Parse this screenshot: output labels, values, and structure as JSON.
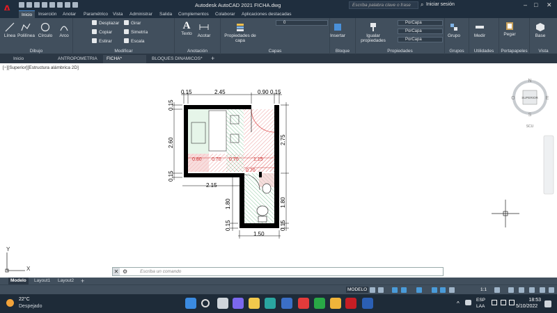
{
  "app": {
    "window_title": "Autodesk AutoCAD 2021   FICHA.dwg",
    "search_placeholder": "Escriba palabra clave o frase",
    "signin": "Iniciar sesión"
  },
  "ribbon_tabs": [
    "Inicio",
    "Inserción",
    "Anotar",
    "Paramétrico",
    "Vista",
    "Administrar",
    "Salida",
    "Complementos",
    "Colaborar",
    "Aplicaciones destacadas"
  ],
  "panels": {
    "dibujo": {
      "title": "Dibujo",
      "tools": [
        "Línea",
        "Polilínea",
        "Círculo",
        "Arco"
      ]
    },
    "modificar": {
      "title": "Modificar",
      "tools": [
        "Desplazar",
        "Girar",
        "Copiar",
        "Simetría",
        "Estirar",
        "Escala"
      ]
    },
    "anotacion": {
      "title": "Anotación",
      "tools": [
        "Texto",
        "Acotar"
      ]
    },
    "capas": {
      "title": "Capas",
      "props_label": "Propiedades de capa",
      "layer_value": "0"
    },
    "bloque": {
      "title": "Bloque",
      "tools": [
        "Insertar"
      ]
    },
    "propiedades": {
      "title": "Propiedades",
      "match": "Igualar propiedades",
      "bylayer1": "PorCapa",
      "bylayer2": "PorCapa",
      "bylayer3": "PorCapa"
    },
    "grupos": {
      "title": "Grupos",
      "tools": [
        "Grupo"
      ]
    },
    "utilidades": {
      "title": "Utilidades",
      "tools": [
        "Medir"
      ]
    },
    "portapapeles": {
      "title": "Portapapeles",
      "tools": [
        "Pegar"
      ]
    },
    "vista": {
      "title": "Vista",
      "tools": [
        "Base"
      ]
    }
  },
  "doc_tabs": [
    "Inicio",
    "ANTROPOMETRIA",
    "FICHA*",
    "BLOQUES DINAMICOS*"
  ],
  "viewport_label": "[−][Superior][Estructura alámbrica 2D]",
  "viewcube": {
    "n": "N",
    "s": "S",
    "e": "E",
    "o": "O",
    "face": "SUPERIOR",
    "wcs": "SCU"
  },
  "ucs": {
    "x": "X",
    "y": "Y"
  },
  "dimensions": {
    "top_left": "0.15",
    "top_mid": "2.45",
    "top_door": "0.90",
    "top_right": "0.15",
    "left_top": "0.15",
    "left_mid": "2.60",
    "left_bot": "0.15",
    "right_mid": "2.75",
    "inner_a": "0.80",
    "inner_b": "0.70",
    "inner_c": "0.70",
    "inner_d": "1.15",
    "inner_e": "0.70",
    "bottom_wide": "2.15",
    "bath_left": "1.80",
    "bath_left_small": "0.15",
    "bath_right": "1.80",
    "bath_right_small": "0.15",
    "bath_bottom": "1.50"
  },
  "command": {
    "placeholder": "Escriba un comando"
  },
  "layout_tabs": [
    "Modelo",
    "Layout1",
    "Layout2"
  ],
  "status": {
    "mode": "MODELO",
    "scale": "1:1"
  },
  "taskbar": {
    "temp": "22°C",
    "weather": "Despejado",
    "lang1": "ESP",
    "lang2": "LAA",
    "time": "18:53",
    "date": "5/10/2022"
  }
}
